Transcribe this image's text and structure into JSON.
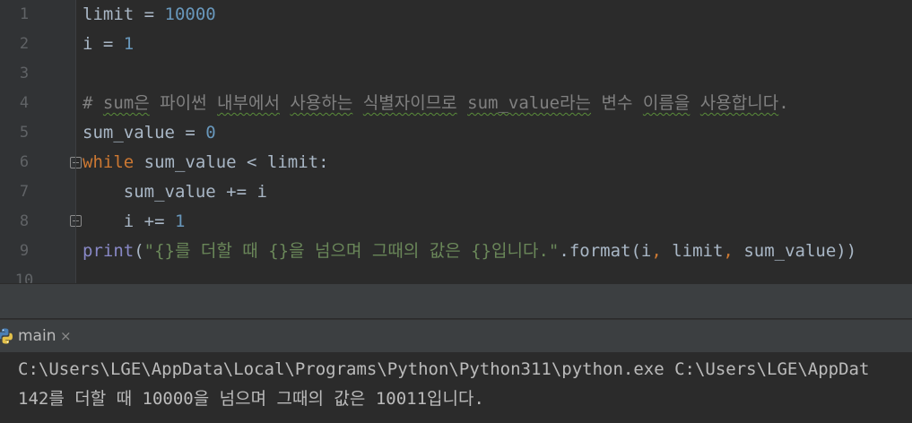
{
  "editor": {
    "line_numbers": [
      "1",
      "2",
      "3",
      "4",
      "5",
      "6",
      "7",
      "8",
      "9",
      "10"
    ],
    "lines": [
      {
        "limit_var": "limit",
        "op": " = ",
        "num": "10000"
      },
      {
        "var": "i",
        "op": " = ",
        "num": "1"
      },
      {},
      {
        "comment_a": "# ",
        "comment_b": "sum은",
        "comment_c": " 파이썬 ",
        "comment_d": "내부에서",
        "comment_e": " ",
        "comment_f": "사용하는",
        "comment_g": " ",
        "comment_h": "식별자이므로",
        "comment_i": " ",
        "comment_j": "sum_value라는",
        "comment_k": " 변수 ",
        "comment_l": "이름을",
        "comment_m": " ",
        "comment_n": "사용합니다",
        "comment_o": "."
      },
      {
        "var": "sum_value",
        "op": " = ",
        "num": "0"
      },
      {
        "kw": "while",
        "rest": " sum_value < limit:"
      },
      {
        "text": "    sum_value += i"
      },
      {
        "pre": "    i += ",
        "num": "1"
      },
      {
        "fn": "print",
        "open": "(",
        "str": "\"{}를 더할 때 {}을 넘으며 그때의 값은 {}입니다.\"",
        "mid": ".format(i",
        "comma1": ",",
        "arg2": " limit",
        "comma2": ",",
        "arg3": " sum_value))"
      }
    ]
  },
  "run_panel": {
    "tab_label": "main",
    "close_glyph": "×",
    "icon": "python-icon"
  },
  "console": {
    "lines": [
      "C:\\Users\\LGE\\AppData\\Local\\Programs\\Python\\Python311\\python.exe C:\\Users\\LGE\\AppDat",
      "142를 더할 때 10000을 넘으며 그때의 값은 10011입니다."
    ]
  },
  "colors": {
    "background": "#2b2b2b",
    "gutter": "#313335",
    "keyword": "#cc7832",
    "number": "#6897bb",
    "comment": "#808080",
    "string": "#6a8759",
    "builtin": "#8888c6",
    "text": "#a9b7c6"
  }
}
